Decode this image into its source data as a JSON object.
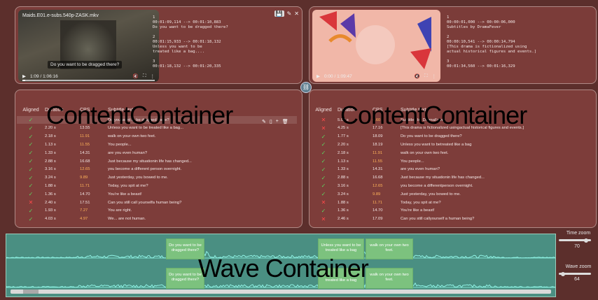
{
  "left": {
    "video": {
      "title": "Maids.E01.e-subs.540p-ZASK.mkv",
      "time": "1:09 / 1:06:16",
      "caption": "Do you want to be dragged there?"
    },
    "srt": "1\n00:01:09,114 --> 00:01:10,883\nDo you want to be dragged there?\n\n2\n00:01:15,933 --> 00:01:18,132\nUnless you want to be\ntreated like a bag....\n\n3\n00:01:18,132 --> 00:01:20,335",
    "overlay": "ContentContainer",
    "table": {
      "headers": [
        "Aligned",
        "Duration",
        "CPS",
        "Subtitle text"
      ],
      "rows": [
        {
          "aligned": "ok",
          "dur": "",
          "cps": "",
          "text": "Do you want to be dragged there?"
        },
        {
          "aligned": "ok",
          "dur": "2.20 s",
          "cps": "13.55",
          "cps_warn": false,
          "text": "Unless you want to be treated like a bag..."
        },
        {
          "aligned": "ok",
          "dur": "2.18 s",
          "cps": "11.91",
          "cps_warn": true,
          "text": "walk on your own two feet."
        },
        {
          "aligned": "ok",
          "dur": "1.13 s",
          "cps": "11.55",
          "cps_warn": true,
          "text": "You people..."
        },
        {
          "aligned": "ok",
          "dur": "1.33 s",
          "cps": "14.31",
          "cps_warn": false,
          "text": "are you even human?"
        },
        {
          "aligned": "ok",
          "dur": "2.88 s",
          "cps": "16.68",
          "cps_warn": false,
          "text": "Just because my situationin life has changed..."
        },
        {
          "aligned": "ok",
          "dur": "3.16 s",
          "cps": "12.65",
          "cps_warn": true,
          "text": "you become a different person overnight."
        },
        {
          "aligned": "ok",
          "dur": "3.24 s",
          "cps": "9.89",
          "cps_warn": true,
          "text": "Just yesterday, you bowed to me."
        },
        {
          "aligned": "ok",
          "dur": "1.88 s",
          "cps": "11.71",
          "cps_warn": true,
          "text": "Today, you spit at me?"
        },
        {
          "aligned": "ok",
          "dur": "1.36 s",
          "cps": "14.70",
          "cps_warn": false,
          "text": "You're like a beast!"
        },
        {
          "aligned": "bad",
          "dur": "2.40 s",
          "cps": "17.51",
          "cps_warn": false,
          "text": "Can you still call yourselfa human being?"
        },
        {
          "aligned": "ok",
          "dur": "1.93 s",
          "cps": "7.27",
          "cps_warn": true,
          "text": "You are right."
        },
        {
          "aligned": "ok",
          "dur": "4.03 s",
          "cps": "4.97",
          "cps_warn": true,
          "text": "We... are not human."
        }
      ]
    }
  },
  "right": {
    "video": {
      "time": "0:00 / 1:09:47"
    },
    "srt": "1\n00:00:01,000 --> 00:00:06,000\nSubtitles by DramaFever\n\n2\n00:00:10,541 --> 00:00:14,794\n[This drama is fictionalized using\nactual historical figures and events.]\n\n3\n00:01:34,560 --> 00:01:16,329",
    "overlay": "ContentContainer",
    "table": {
      "headers": [
        "Aligned",
        "Duration",
        "CPS",
        "Subtitle text"
      ],
      "rows": [
        {
          "aligned": "bad",
          "dur": "5.00 s",
          "cps": "4.60",
          "cps_warn": true,
          "text": "Subtitles by DramaFever"
        },
        {
          "aligned": "bad",
          "dur": "4.25 s",
          "cps": "17.16",
          "cps_warn": false,
          "text": "[This drama is fictionalized usingactual historical figures and events.]"
        },
        {
          "aligned": "ok",
          "dur": "1.77 s",
          "cps": "18.09",
          "cps_warn": false,
          "text": "Do you want to be dragged there?"
        },
        {
          "aligned": "ok",
          "dur": "2.20 s",
          "cps": "18.19",
          "cps_warn": false,
          "text": "Unless you want to betreated like a bag"
        },
        {
          "aligned": "ok",
          "dur": "2.18 s",
          "cps": "11.91",
          "cps_warn": true,
          "text": "walk on your own two feet."
        },
        {
          "aligned": "ok",
          "dur": "1.13 s",
          "cps": "11.55",
          "cps_warn": true,
          "text": "You people..."
        },
        {
          "aligned": "ok",
          "dur": "1.33 s",
          "cps": "14.31",
          "cps_warn": false,
          "text": "are you even human?"
        },
        {
          "aligned": "ok",
          "dur": "2.88 s",
          "cps": "16.68",
          "cps_warn": false,
          "text": "Just because my situationin life has changed..."
        },
        {
          "aligned": "ok",
          "dur": "3.16 s",
          "cps": "12.65",
          "cps_warn": true,
          "text": "you become a differentperson overnight."
        },
        {
          "aligned": "ok",
          "dur": "3.24 s",
          "cps": "9.89",
          "cps_warn": true,
          "text": "Just yesterday, you bowed to me."
        },
        {
          "aligned": "bad",
          "dur": "1.88 s",
          "cps": "11.71",
          "cps_warn": true,
          "text": "Today, you spit at me?"
        },
        {
          "aligned": "ok",
          "dur": "1.36 s",
          "cps": "14.70",
          "cps_warn": false,
          "text": "You're like a beast!"
        },
        {
          "aligned": "bad",
          "dur": "2.46 s",
          "cps": "17.09",
          "cps_warn": false,
          "text": "Can you still callyourself a human being?"
        }
      ]
    }
  },
  "wave": {
    "overlay": "Wave Container",
    "regions_top": [
      {
        "text": "Do you want to be dragged there?"
      },
      {
        "text": "Unless you want to be treated like a bag"
      },
      {
        "text": "walk on your own two feet."
      }
    ],
    "regions_bottom": [
      {
        "text": "Do you want to be dragged there?"
      },
      {
        "text": "treated like a bag"
      },
      {
        "text": "walk on your own two feet."
      }
    ]
  },
  "controls": {
    "time_zoom_label": "Time zoom",
    "time_zoom_value": "70",
    "time_zoom_level": 0.85,
    "wave_zoom_label": "Wave zoom",
    "wave_zoom_value": "64",
    "wave_zoom_level": 0.12
  }
}
